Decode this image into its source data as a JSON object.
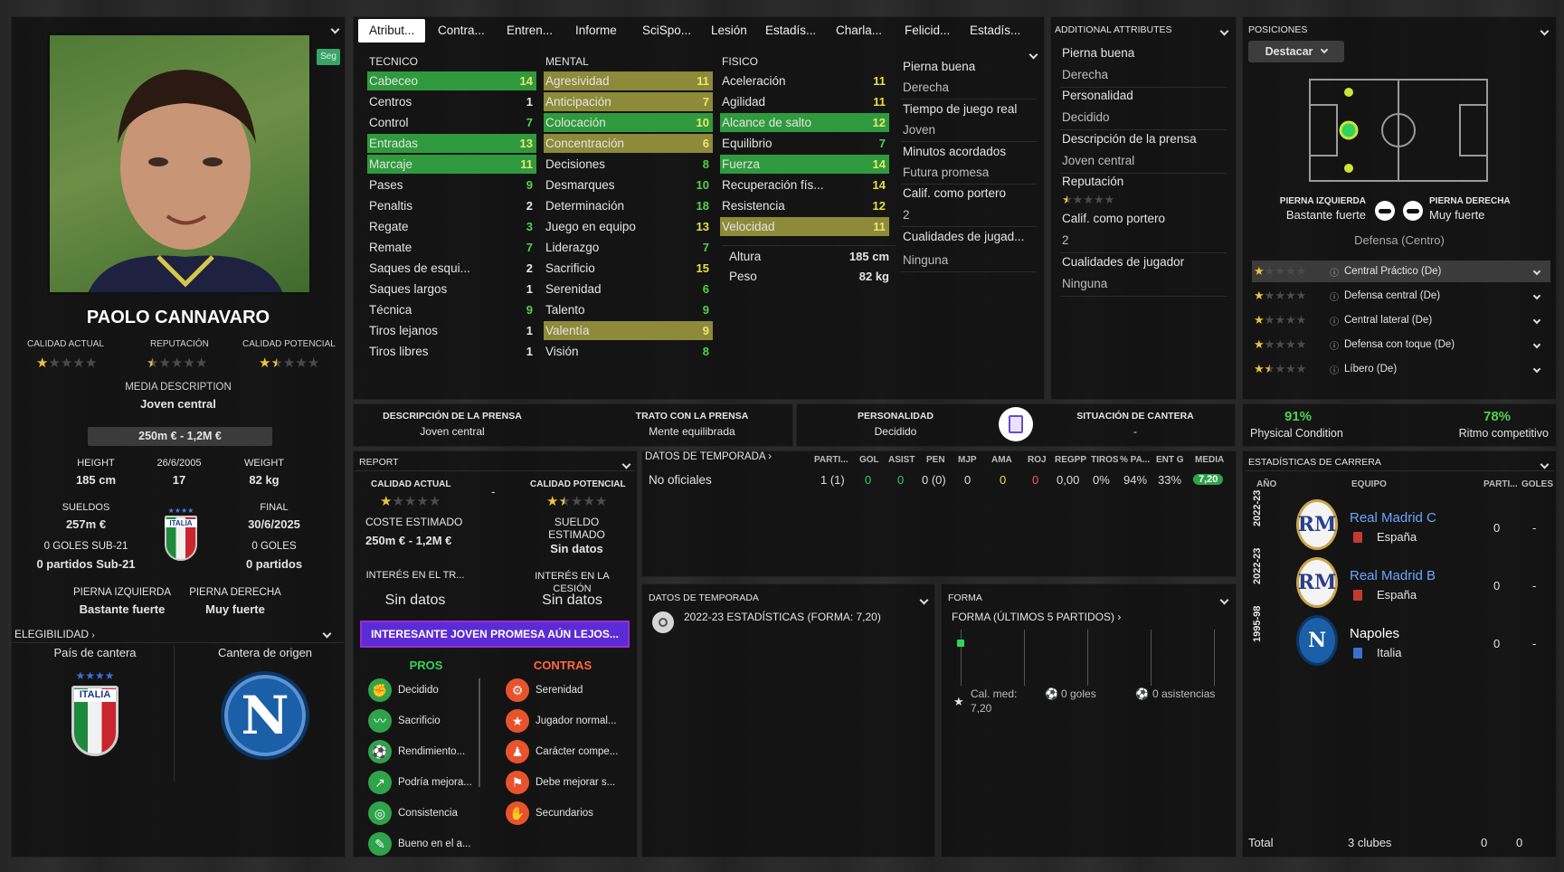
{
  "tabs": [
    "Atribut...",
    "Contra...",
    "Entren...",
    "Informe",
    "SciSpo...",
    "Lesión",
    "Estadís...",
    "Charla...",
    "Felicid...",
    "Estadís..."
  ],
  "profile": {
    "seg": "Seg",
    "name": "PAOLO CANNAVARO",
    "ca_label": "CALIDAD ACTUAL",
    "rep_label": "REPUTACIÓN",
    "pa_label": "CALIDAD POTENCIAL",
    "ca_stars": 1,
    "rep_stars": 0.5,
    "pa_stars": 1.5,
    "media_label": "MEDIA DESCRIPTION",
    "media_value": "Joven central",
    "value_range": "250m € - 1,2M €",
    "height_label": "HEIGHT",
    "height": "185 cm",
    "dob": "26/6/2005",
    "age": "17",
    "weight_label": "WEIGHT",
    "weight": "82 kg",
    "wages_label": "SUELDOS",
    "wages": "257m €",
    "end_label": "FINAL",
    "end_date": "30/6/2025",
    "nat_badge": "ITALIA",
    "u21_goals": "0 GOLES SUB-21",
    "u21_apps": "0 partidos Sub-21",
    "goals": "0 GOLES",
    "apps": "0 partidos",
    "lf_label": "PIERNA IZQUIERDA",
    "lf": "Bastante fuerte",
    "rf_label": "PIERNA DERECHA",
    "rf": "Muy fuerte",
    "eleg_label": "ELEGIBILIDAD",
    "pais_label": "País de cantera",
    "cantera_label": "Cantera de origen",
    "cantera_letter": "N"
  },
  "attrs": {
    "tec_label": "TECNICO",
    "men_label": "MENTAL",
    "fis_label": "FISICO",
    "tec": [
      [
        "Cabeceo",
        "14"
      ],
      [
        "Centros",
        "1"
      ],
      [
        "Control",
        "7"
      ],
      [
        "Entradas",
        "13"
      ],
      [
        "Marcaje",
        "11"
      ],
      [
        "Pases",
        "9"
      ],
      [
        "Penaltis",
        "2"
      ],
      [
        "Regate",
        "3"
      ],
      [
        "Remate",
        "7"
      ],
      [
        "Saques de esqui...",
        "2"
      ],
      [
        "Saques largos",
        "1"
      ],
      [
        "Técnica",
        "9"
      ],
      [
        "Tiros lejanos",
        "1"
      ],
      [
        "Tiros libres",
        "1"
      ]
    ],
    "men": [
      [
        "Agresividad",
        "11"
      ],
      [
        "Anticipación",
        "7"
      ],
      [
        "Colocación",
        "10"
      ],
      [
        "Concentración",
        "6"
      ],
      [
        "Decisiones",
        "8"
      ],
      [
        "Desmarques",
        "10"
      ],
      [
        "Determinación",
        "18"
      ],
      [
        "Juego en equipo",
        "13"
      ],
      [
        "Liderazgo",
        "7"
      ],
      [
        "Sacrificio",
        "15"
      ],
      [
        "Serenidad",
        "6"
      ],
      [
        "Talento",
        "9"
      ],
      [
        "Valentía",
        "9"
      ],
      [
        "Visión",
        "8"
      ]
    ],
    "fis": [
      [
        "Aceleración",
        "11"
      ],
      [
        "Agilidad",
        "11"
      ],
      [
        "Alcance de salto",
        "12"
      ],
      [
        "Equilibrio",
        "7"
      ],
      [
        "Fuerza",
        "14"
      ],
      [
        "Recuperación fís...",
        "14"
      ],
      [
        "Resistencia",
        "12"
      ],
      [
        "Velocidad",
        "11"
      ]
    ],
    "height_label": "Altura",
    "height": "185 cm",
    "weight_label": "Peso",
    "weight": "82 kg"
  },
  "side_info": [
    "Pierna buena",
    "Derecha",
    "Tiempo de juego real",
    "Joven",
    "Minutos acordados",
    "Futura promesa",
    "Calif. como portero",
    "2",
    "Cualidades de jugad...",
    "Ninguna"
  ],
  "additional": {
    "title": "ADDITIONAL ATTRIBUTES",
    "items": [
      "Pierna buena",
      "Derecha",
      "Personalidad",
      "Decidido",
      "Descripción de la prensa",
      "Joven central",
      "Reputación"
    ],
    "rep_stars": 0.5,
    "items2": [
      "Calif. como portero",
      "2",
      "Cualidades de jugador",
      "Ninguna"
    ]
  },
  "positions": {
    "title": "POSICIONES",
    "dropdown": "Destacar",
    "lf_label": "PIERNA IZQUIERDA",
    "lf": "Bastante fuerte",
    "rf_label": "PIERNA DERECHA",
    "rf": "Muy fuerte",
    "role": "Defensa (Centro)",
    "list": [
      {
        "name": "Central Práctico (De)",
        "stars": 1
      },
      {
        "name": "Defensa central (De)",
        "stars": 1
      },
      {
        "name": "Central lateral (De)",
        "stars": 1
      },
      {
        "name": "Defensa con toque (De)",
        "stars": 1
      },
      {
        "name": "Líbero (De)",
        "stars": 1.5
      }
    ]
  },
  "press": {
    "desc_label": "DESCRIPCIÓN DE LA PRENSA",
    "desc": "Joven central",
    "trato_label": "TRATO CON LA PRENSA",
    "trato": "Mente equilibrada",
    "pers_label": "PERSONALIDAD",
    "pers": "Decidido",
    "cant_label": "SITUACIÓN DE CANTERA",
    "cant": "-"
  },
  "condition": {
    "pc": "91%",
    "pc_label": "Physical Condition",
    "rc": "78%",
    "rc_label": "Ritmo competitivo"
  },
  "report": {
    "title": "REPORT",
    "ca_label": "CALIDAD ACTUAL",
    "ca_stars": 1,
    "dash": "-",
    "pa_label": "CALIDAD POTENCIAL",
    "pa_stars": 1.5,
    "cost_label": "COSTE ESTIMADO",
    "cost": "250m € - 1,2M €",
    "wage_label": "SUELDO ESTIMADO",
    "wage": "Sin datos",
    "int_tr_label": "INTERÉS EN EL TR...",
    "int_tr": "Sin datos",
    "int_ces_label": "INTERÉS EN LA CESIÓN",
    "int_ces": "Sin datos",
    "banner": "INTERESANTE JOVEN PROMESA AÚN LEJOS...",
    "pros_label": "PROS",
    "contras_label": "CONTRAS",
    "pros": [
      "Decidido",
      "Sacrificio",
      "Rendimiento...",
      "Podría mejora...",
      "Consistencia",
      "Bueno en el a..."
    ],
    "contras": [
      "Serenidad",
      "Jugador normal...",
      "Carácter compe...",
      "Debe mejorar s...",
      "Secundarios"
    ]
  },
  "season": {
    "title": "DATOS DE TEMPORADA",
    "headers": [
      "PARTI...",
      "GOL",
      "ASIST",
      "PEN",
      "MJP",
      "AMA",
      "ROJ",
      "REGPP",
      "TIROS",
      "% PA...",
      "ENT G",
      "MEDIA"
    ],
    "row_label": "No oficiales",
    "values": [
      "1 (1)",
      "0",
      "0",
      "0 (0)",
      "0",
      "0",
      "0",
      "0,00",
      "0%",
      "94%",
      "33%",
      "7,20"
    ]
  },
  "season2": {
    "title": "DATOS DE TEMPORADA",
    "line": "2022-23 ESTADÍSTICAS (FORMA: 7,20)"
  },
  "form": {
    "title": "FORMA",
    "sub": "FORMA (ÚLTIMOS 5 PARTIDOS)",
    "avg_label": "Cal. med:",
    "avg": "7,20",
    "goals": "0 goles",
    "assists": "0 asistencias"
  },
  "career": {
    "title": "ESTADÍSTICAS DE CARRERA",
    "h_year": "AÑO",
    "h_team": "EQUIPO",
    "h_apps": "PARTI...",
    "h_goals": "GOLES",
    "rows": [
      {
        "year": "2022-23",
        "team": "Real Madrid C",
        "country": "España",
        "apps": "0",
        "goals": "-"
      },
      {
        "year": "2022-23",
        "team": "Real Madrid B",
        "country": "España",
        "apps": "0",
        "goals": "-"
      },
      {
        "year": "1995-98",
        "team": "Napoles",
        "country": "Italia",
        "apps": "0",
        "goals": "-"
      }
    ],
    "total_label": "Total",
    "total_clubs": "3 clubes",
    "total_apps": "0",
    "total_goals": "0"
  },
  "colors": {
    "green": "#2f9a3d",
    "yellow": "#8d8a3a",
    "accent": "#5b2bd6",
    "link": "#6aa6ff",
    "star": "#f0c43a"
  }
}
